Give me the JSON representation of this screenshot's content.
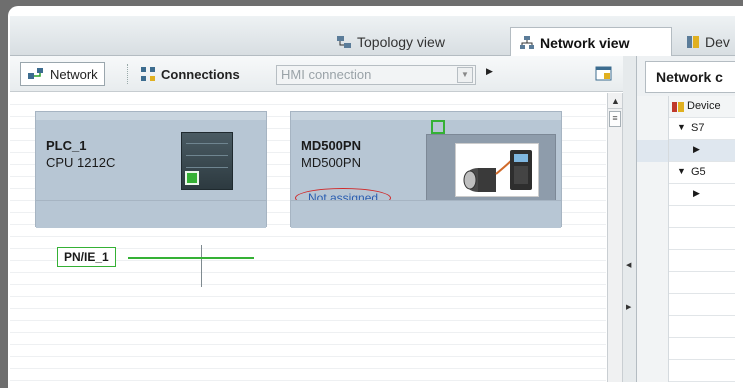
{
  "view_tabs": [
    {
      "label": "Topology view",
      "active": false
    },
    {
      "label": "Network view",
      "active": true
    },
    {
      "label": "Dev",
      "active": false
    }
  ],
  "toolbar": {
    "network_label": "Network",
    "connections_label": "Connections",
    "connection_type": "HMI connection"
  },
  "canvas": {
    "plc": {
      "name": "PLC_1",
      "type": "CPU 1212C"
    },
    "drive": {
      "name": "MD500PN",
      "type": "MD500PN",
      "status": "Not assigned"
    },
    "subnet": {
      "label": "PN/IE_1"
    }
  },
  "right_panel": {
    "tab_label": "Network c",
    "column_header": "Device",
    "rows": [
      "S7",
      "",
      "G5",
      ""
    ]
  },
  "colors": {
    "subnet_green": "#35b135",
    "device_body": "#b7c6d4",
    "annotation_red": "#d02a2a",
    "status_blue": "#2a5db0"
  }
}
